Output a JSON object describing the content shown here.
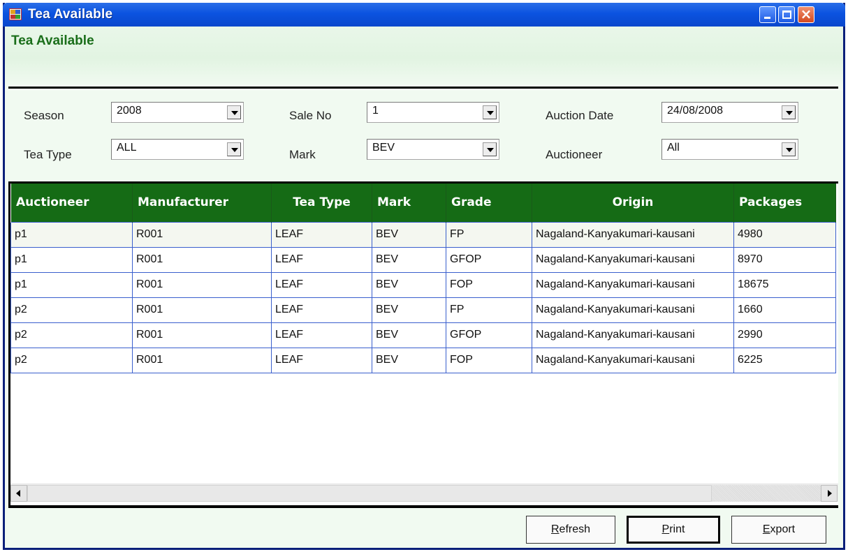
{
  "window": {
    "title": "Tea Available"
  },
  "header": {
    "title": "Tea Available"
  },
  "filters": {
    "season": {
      "label": "Season",
      "value": "2008"
    },
    "sale_no": {
      "label": "Sale No",
      "value": "1"
    },
    "auction_date": {
      "label": "Auction Date",
      "value": "24/08/2008"
    },
    "tea_type": {
      "label": "Tea Type",
      "value": "ALL"
    },
    "mark": {
      "label": "Mark",
      "value": "BEV"
    },
    "auctioneer": {
      "label": "Auctioneer",
      "value": "All"
    }
  },
  "grid": {
    "columns": [
      "Auctioneer",
      "Manufacturer",
      "Tea Type",
      "Mark",
      "Grade",
      "Origin",
      "Packages"
    ],
    "rows": [
      [
        "p1",
        "R001",
        "LEAF",
        "BEV",
        "FP",
        "Nagaland-Kanyakumari-kausani",
        "4980"
      ],
      [
        "p1",
        "R001",
        "LEAF",
        "BEV",
        "GFOP",
        "Nagaland-Kanyakumari-kausani",
        "8970"
      ],
      [
        "p1",
        "R001",
        "LEAF",
        "BEV",
        "FOP",
        "Nagaland-Kanyakumari-kausani",
        "18675"
      ],
      [
        "p2",
        "R001",
        "LEAF",
        "BEV",
        "FP",
        "Nagaland-Kanyakumari-kausani",
        "1660"
      ],
      [
        "p2",
        "R001",
        "LEAF",
        "BEV",
        "GFOP",
        "Nagaland-Kanyakumari-kausani",
        "2990"
      ],
      [
        "p2",
        "R001",
        "LEAF",
        "BEV",
        "FOP",
        "Nagaland-Kanyakumari-kausani",
        "6225"
      ]
    ]
  },
  "buttons": {
    "refresh": {
      "mnemonic": "R",
      "rest": "efresh"
    },
    "print": {
      "mnemonic": "P",
      "rest": "rint"
    },
    "export": {
      "mnemonic": "E",
      "rest": "xport"
    }
  },
  "colors": {
    "titlebar": "#0b53e0",
    "header_text": "#1a6e1a",
    "grid_header": "#156b15",
    "grid_border": "#3a5fcd"
  },
  "icons": [
    "app-icon",
    "minimize-icon",
    "maximize-icon",
    "close-icon",
    "dropdown-arrow-icon",
    "scroll-left-icon",
    "scroll-right-icon"
  ]
}
